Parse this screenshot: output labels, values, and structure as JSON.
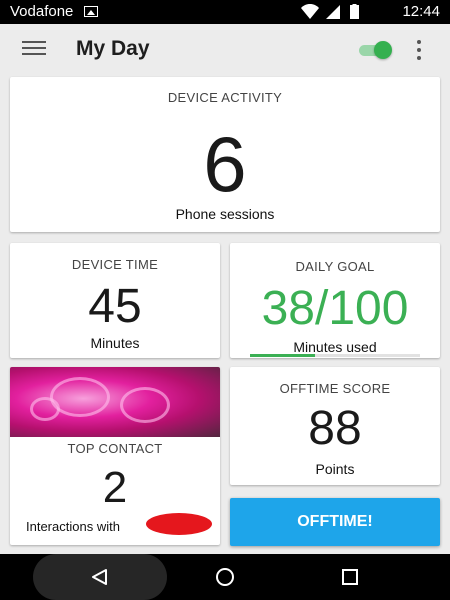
{
  "status_bar": {
    "carrier": "Vodafone",
    "time": "12:44",
    "icons": [
      "image-icon",
      "wifi-icon",
      "signal-icon",
      "battery-icon"
    ]
  },
  "app_bar": {
    "title": "My Day",
    "toggle_on": true,
    "icons": [
      "menu-icon",
      "overflow-icon"
    ]
  },
  "device_activity": {
    "label": "DEVICE ACTIVITY",
    "value": "6",
    "caption": "Phone sessions"
  },
  "device_time": {
    "label": "DEVICE TIME",
    "value": "45",
    "caption": "Minutes"
  },
  "daily_goal": {
    "label": "DAILY GOAL",
    "value": "38/100",
    "caption": "Minutes used",
    "progress": 0.38
  },
  "top_contact": {
    "label": "TOP CONTACT",
    "value": "2",
    "caption": "Interactions with"
  },
  "offtime_score": {
    "label": "OFFTIME SCORE",
    "value": "88",
    "caption": "Points"
  },
  "offtime_button": {
    "label": "OFFTIME!"
  },
  "colors": {
    "accent_green": "#3bb054",
    "button_blue": "#1ea5ea",
    "redaction_red": "#e5171d"
  },
  "nav_bar": {
    "icons": [
      "back-icon",
      "home-icon",
      "recents-icon"
    ]
  }
}
